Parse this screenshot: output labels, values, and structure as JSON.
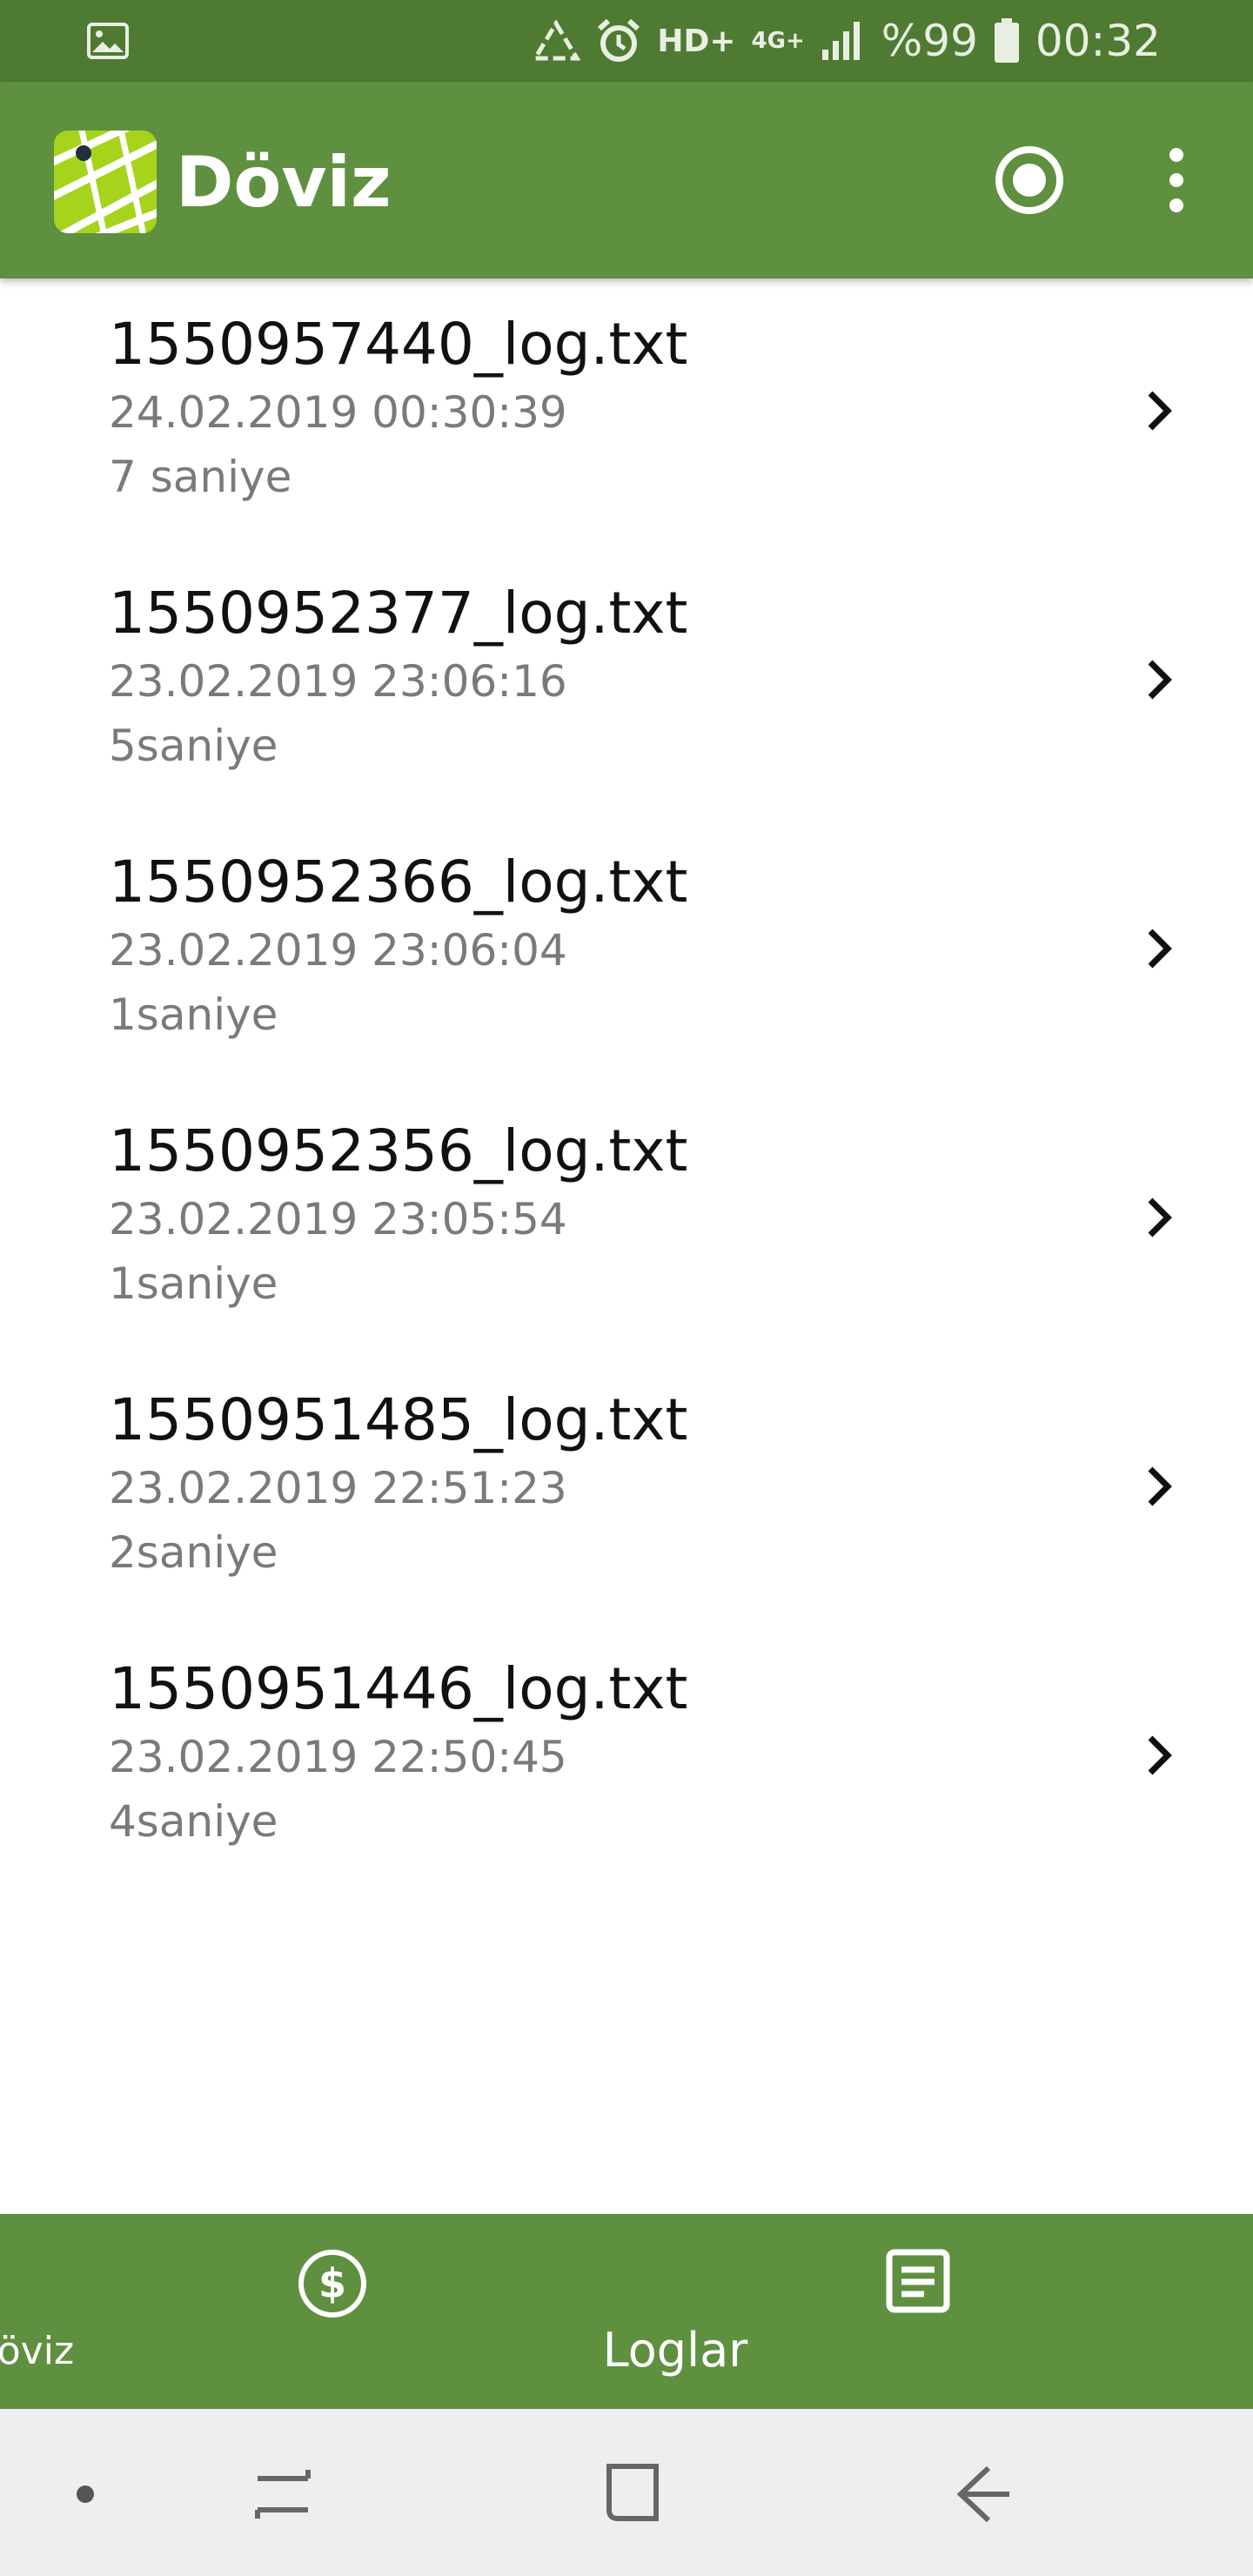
{
  "status_bar": {
    "network": "HD+",
    "network_type": "4G+",
    "battery": "%99",
    "time": "00:32"
  },
  "app_bar": {
    "title": "Döviz"
  },
  "logs": [
    {
      "name": "1550957440_log.txt",
      "date": "24.02.2019 00:30:39",
      "duration": "7 saniye"
    },
    {
      "name": "1550952377_log.txt",
      "date": "23.02.2019 23:06:16",
      "duration": "5saniye"
    },
    {
      "name": "1550952366_log.txt",
      "date": "23.02.2019 23:06:04",
      "duration": "1saniye"
    },
    {
      "name": "1550952356_log.txt",
      "date": "23.02.2019 23:05:54",
      "duration": "1saniye"
    },
    {
      "name": "1550951485_log.txt",
      "date": "23.02.2019 22:51:23",
      "duration": "2saniye"
    },
    {
      "name": "1550951446_log.txt",
      "date": "23.02.2019 22:50:45",
      "duration": "4saniye"
    }
  ],
  "bottom_nav": {
    "items": [
      {
        "label": "Döviz",
        "icon": "dollar-circle-icon"
      },
      {
        "label": "Loglar",
        "icon": "document-list-icon"
      }
    ]
  },
  "colors": {
    "status_bar": "#4e7a31",
    "app_bar": "#5e9040",
    "bottom_nav": "#5e9040",
    "system_nav": "#eeeeee"
  }
}
